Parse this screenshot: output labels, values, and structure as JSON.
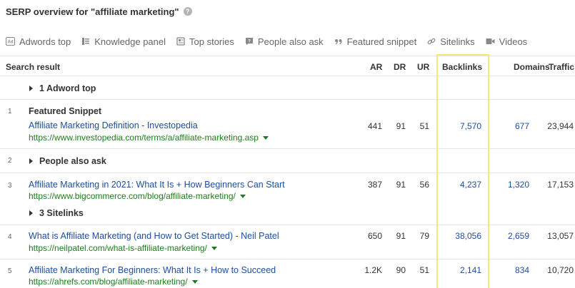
{
  "header": {
    "title": "SERP overview for \"affiliate marketing\"",
    "help": "?"
  },
  "features": [
    {
      "icon": "adwords-icon",
      "label": "Adwords top"
    },
    {
      "icon": "knowledge-panel-icon",
      "label": "Knowledge panel"
    },
    {
      "icon": "top-stories-icon",
      "label": "Top stories"
    },
    {
      "icon": "people-also-ask-icon",
      "label": "People also ask"
    },
    {
      "icon": "quote-icon",
      "label": "Featured snippet"
    },
    {
      "icon": "link-icon",
      "label": "Sitelinks"
    },
    {
      "icon": "video-icon",
      "label": "Videos"
    }
  ],
  "columns": {
    "result": "Search result",
    "ar": "AR",
    "dr": "DR",
    "ur": "UR",
    "backlinks": "Backlinks",
    "domains": "Domains",
    "traffic": "Traffic"
  },
  "rows": {
    "adword_group": "1 Adword top",
    "r1": {
      "num": "1",
      "label": "Featured Snippet",
      "title": "Affiliate Marketing Definition - Investopedia",
      "url": "https://www.investopedia.com/terms/a/affiliate-marketing.asp",
      "ar": "441",
      "dr": "91",
      "ur": "51",
      "backlinks": "7,570",
      "domains": "677",
      "traffic": "23,944"
    },
    "r2": {
      "num": "2",
      "label": "People also ask"
    },
    "r3": {
      "num": "3",
      "title": "Affiliate Marketing in 2021: What It Is + How Beginners Can Start",
      "url": "https://www.bigcommerce.com/blog/affiliate-marketing/",
      "ar": "387",
      "dr": "91",
      "ur": "56",
      "backlinks": "4,237",
      "domains": "1,320",
      "traffic": "17,153",
      "sitelinks": "3 Sitelinks"
    },
    "r4": {
      "num": "4",
      "title": "What is Affiliate Marketing (and How to Get Started) - Neil Patel",
      "url": "https://neilpatel.com/what-is-affiliate-marketing/",
      "ar": "650",
      "dr": "91",
      "ur": "79",
      "backlinks": "38,056",
      "domains": "2,659",
      "traffic": "13,057"
    },
    "r5": {
      "num": "5",
      "title": "Affiliate Marketing For Beginners: What It Is + How to Succeed",
      "url": "https://ahrefs.com/blog/affiliate-marketing/",
      "ar": "1.2K",
      "dr": "90",
      "ur": "51",
      "backlinks": "2,141",
      "domains": "834",
      "traffic": "10,720"
    }
  }
}
